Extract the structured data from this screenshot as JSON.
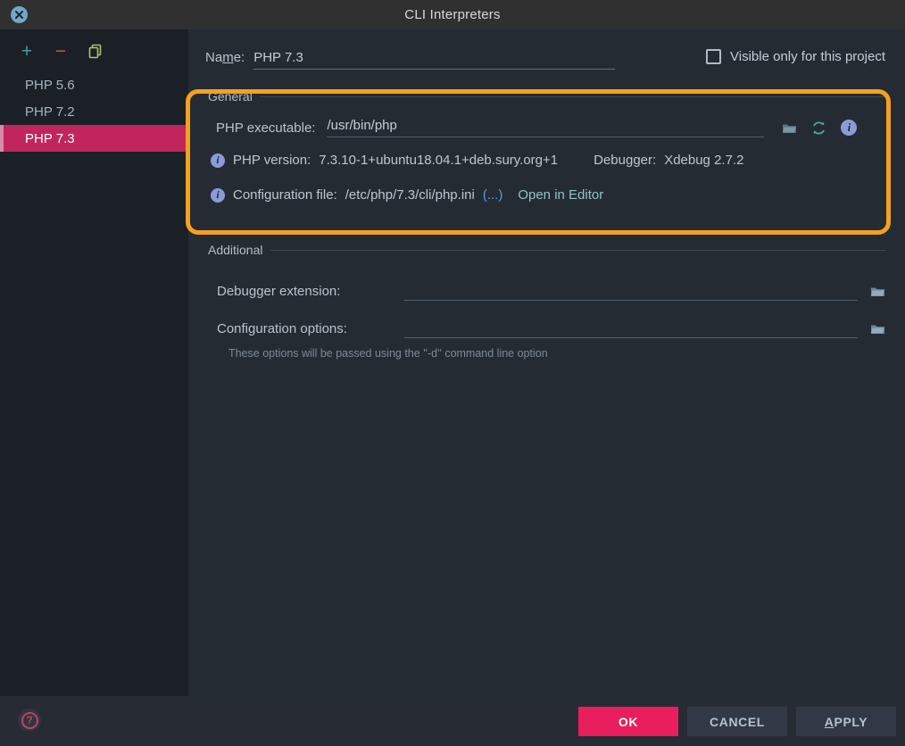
{
  "window": {
    "title": "CLI Interpreters",
    "close_icon": "close-circle-icon"
  },
  "sidebar": {
    "toolbar": [
      {
        "name": "add-interpreter",
        "glyph": "+",
        "icon": "plus-icon"
      },
      {
        "name": "remove-interpreter",
        "glyph": "−",
        "icon": "minus-icon"
      },
      {
        "name": "copy-interpreter",
        "glyph": "",
        "icon": "copy-icon"
      }
    ],
    "items": [
      {
        "label": "PHP 5.6",
        "selected": false
      },
      {
        "label": "PHP 7.2",
        "selected": false
      },
      {
        "label": "PHP 7.3",
        "selected": true
      }
    ]
  },
  "form": {
    "name_label": "Na",
    "name_label_mnemonic": "m",
    "name_label_tail": "e:",
    "name_value": "PHP 7.3",
    "visible_only_label": "Visible only for this project",
    "visible_only_checked": false
  },
  "general": {
    "title": "General",
    "executable_label": "PHP executable:",
    "executable_value": "/usr/bin/php",
    "browse_icon": "folder-icon",
    "refresh_icon": "refresh-icon",
    "info_icon": "info-icon",
    "php_version_label": "PHP version:",
    "php_version_value": "7.3.10-1+ubuntu18.04.1+deb.sury.org+1",
    "debugger_label": "Debugger:",
    "debugger_value": "Xdebug 2.7.2",
    "config_file_label": "Configuration file:",
    "config_file_value": "/etc/php/7.3/cli/php.ini",
    "config_ellipsis": "(...)",
    "open_in_editor": "Open in Editor",
    "highlight_color": "#f5a11f"
  },
  "additional": {
    "title": "Additional",
    "debugger_extension_label": "Debugger extension:",
    "debugger_extension_value": "",
    "configuration_options_label": "Configuration options:",
    "configuration_options_value": "",
    "hint": "These options will be passed using the ''-d'' command line option",
    "browse_icon": "folder-icon"
  },
  "footer": {
    "help_icon": "help-circle-icon",
    "ok_label": "OK",
    "cancel_label": "CANCEL",
    "apply_label_mnemonic": "A",
    "apply_label_tail": "PPLY",
    "ok_color": "#e81f5c"
  }
}
